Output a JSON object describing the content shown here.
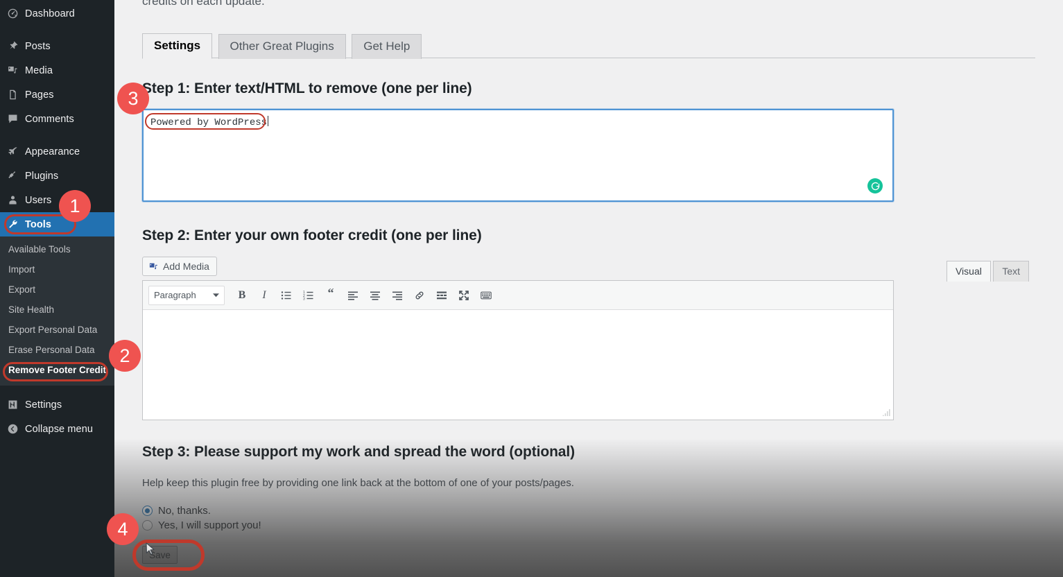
{
  "sidebar": {
    "items": [
      {
        "label": "Dashboard",
        "icon": "dashboard-icon"
      },
      {
        "label": "Posts",
        "icon": "pin-icon"
      },
      {
        "label": "Media",
        "icon": "media-icon"
      },
      {
        "label": "Pages",
        "icon": "pages-icon"
      },
      {
        "label": "Comments",
        "icon": "comments-icon"
      },
      {
        "label": "Appearance",
        "icon": "appearance-icon"
      },
      {
        "label": "Plugins",
        "icon": "plugins-icon"
      },
      {
        "label": "Users",
        "icon": "users-icon"
      },
      {
        "label": "Tools",
        "icon": "wrench-icon"
      },
      {
        "label": "Settings",
        "icon": "settings-icon"
      },
      {
        "label": "Collapse menu",
        "icon": "collapse-icon"
      }
    ],
    "active_item": "Tools",
    "submenu": [
      "Available Tools",
      "Import",
      "Export",
      "Site Health",
      "Export Personal Data",
      "Erase Personal Data",
      "Remove Footer Credit"
    ],
    "submenu_current": "Remove Footer Credit",
    "active_color": "#2271b1",
    "background_color": "#1d2327"
  },
  "annotations": {
    "highlight_color": "#c0392b",
    "marker_color": "#ef5350",
    "markers": [
      {
        "number": "1",
        "target": "tools-menu-item"
      },
      {
        "number": "2",
        "target": "remove-footer-credit-submenu-item"
      },
      {
        "number": "3",
        "target": "step1-textarea"
      },
      {
        "number": "4",
        "target": "save-button"
      }
    ]
  },
  "main": {
    "intro_text": "credits on each update.",
    "tabs": [
      {
        "label": "Settings",
        "active": true
      },
      {
        "label": "Other Great Plugins",
        "active": false
      },
      {
        "label": "Get Help",
        "active": false
      }
    ],
    "step1": {
      "title": "Step 1: Enter text/HTML to remove (one per line)",
      "textarea_value": "Powered by WordPress",
      "textarea_placeholder": "",
      "assistant_icon": "grammarly-icon",
      "assistant_color": "#15c39a"
    },
    "step2": {
      "title": "Step 2: Enter your own footer credit (one per line)",
      "add_media_label": "Add Media",
      "add_media_icon": "media-icon",
      "editor_tabs": [
        {
          "label": "Visual",
          "active": true
        },
        {
          "label": "Text",
          "active": false
        }
      ],
      "format_select_value": "Paragraph",
      "toolbar_buttons": [
        {
          "name": "bold-icon",
          "glyph": "B"
        },
        {
          "name": "italic-icon",
          "glyph": "I"
        },
        {
          "name": "bulleted-list-icon",
          "glyph": ""
        },
        {
          "name": "numbered-list-icon",
          "glyph": ""
        },
        {
          "name": "blockquote-icon",
          "glyph": "“"
        },
        {
          "name": "align-left-icon",
          "glyph": ""
        },
        {
          "name": "align-center-icon",
          "glyph": ""
        },
        {
          "name": "align-right-icon",
          "glyph": ""
        },
        {
          "name": "link-icon",
          "glyph": ""
        },
        {
          "name": "read-more-icon",
          "glyph": ""
        },
        {
          "name": "fullscreen-icon",
          "glyph": ""
        },
        {
          "name": "toolbar-toggle-icon",
          "glyph": ""
        }
      ],
      "editor_content": ""
    },
    "step3": {
      "title": "Step 3: Please support my work and spread the word (optional)",
      "help_text": "Help keep this plugin free by providing one link back at the bottom of one of your posts/pages.",
      "options": [
        {
          "label": "No, thanks.",
          "selected": true
        },
        {
          "label": "Yes, I will support you!",
          "selected": false
        }
      ]
    },
    "save_label": "Save"
  }
}
